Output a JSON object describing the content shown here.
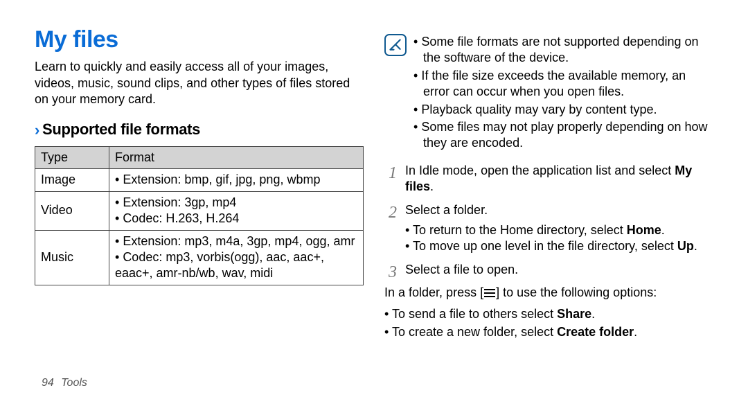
{
  "left": {
    "heading": "My files",
    "intro": "Learn to quickly and easily access all of your images, videos, music, sound clips, and other types of files stored on your memory card.",
    "subheading": "Supported file formats",
    "table": {
      "cols": [
        "Type",
        "Format"
      ],
      "rows": [
        {
          "type": "Image",
          "formats": [
            "Extension: bmp, gif, jpg, png, wbmp"
          ]
        },
        {
          "type": "Video",
          "formats": [
            "Extension: 3gp, mp4",
            "Codec: H.263, H.264"
          ]
        },
        {
          "type": "Music",
          "formats": [
            "Extension: mp3, m4a, 3gp, mp4, ogg, amr",
            "Codec: mp3, vorbis(ogg), aac, aac+, eaac+, amr-nb/wb, wav, midi"
          ]
        }
      ]
    }
  },
  "right": {
    "notes": [
      "Some file formats are not supported depending on the software of the device.",
      "If the file size exceeds the available memory, an error can occur when you open files.",
      "Playback quality may vary by content type.",
      "Some files may not play properly depending on how they are encoded."
    ],
    "step1_a": "In Idle mode, open the application list and select ",
    "step1_b": "My files",
    "step1_c": ".",
    "step2": "Select a folder.",
    "step2_sub_a1": "To return to the Home directory, select ",
    "step2_sub_a2": "Home",
    "step2_sub_a3": ".",
    "step2_sub_b1": "To move up one level in the file directory, select ",
    "step2_sub_b2": "Up",
    "step2_sub_b3": ".",
    "step3": "Select a file to open.",
    "press_a": "In a folder, press [",
    "press_b": "] to use the following options:",
    "opt1_a": "To send a file to others select ",
    "opt1_b": "Share",
    "opt1_c": ".",
    "opt2_a": "To create a new folder, select ",
    "opt2_b": "Create folder",
    "opt2_c": "."
  },
  "footer": {
    "page": "94",
    "section": "Tools"
  }
}
